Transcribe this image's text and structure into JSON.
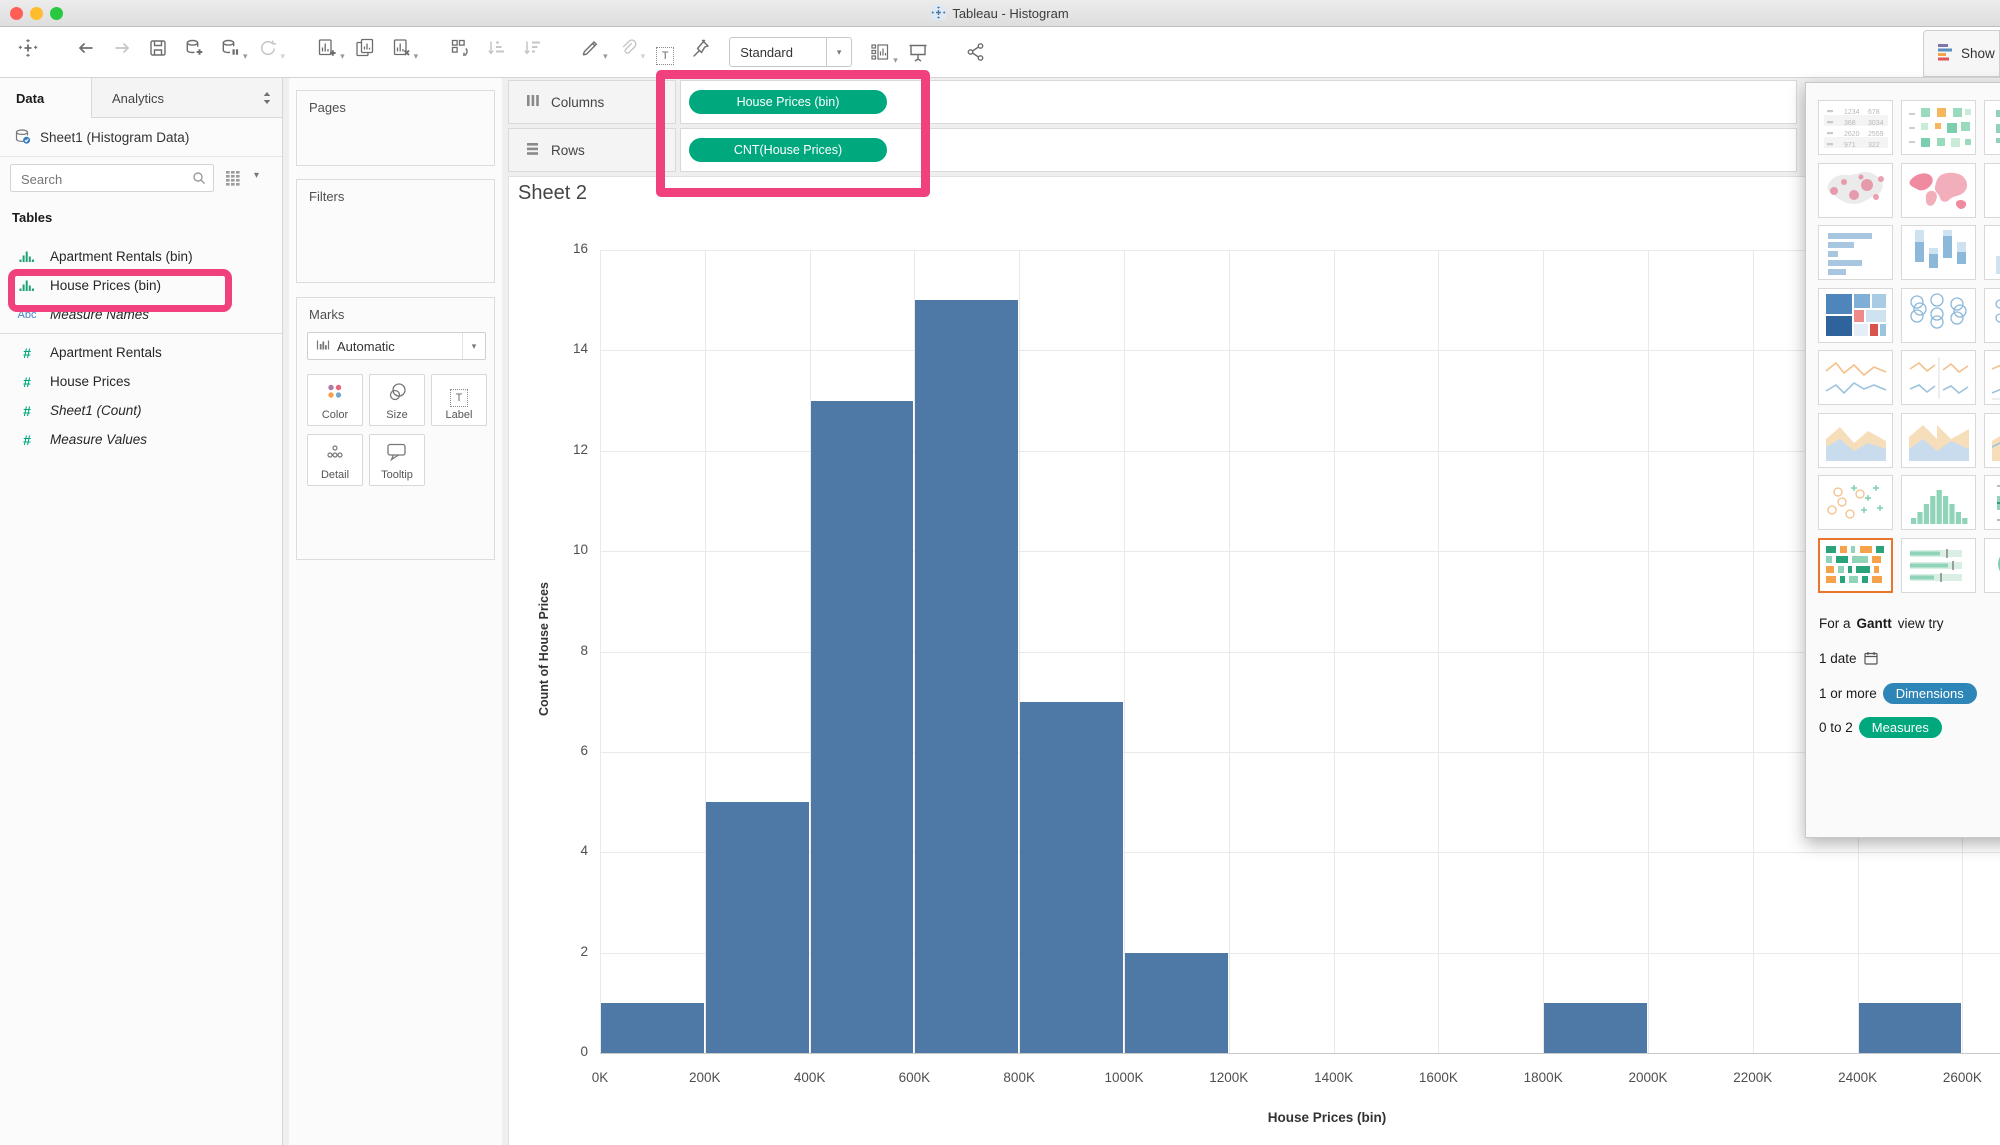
{
  "window": {
    "title": "Tableau - Histogram"
  },
  "toolbar": {
    "items_left": [
      {
        "name": "tableau-logo",
        "disabled": false
      },
      {
        "sep": true
      },
      {
        "name": "back"
      },
      {
        "name": "forward",
        "disabled": true
      },
      {
        "name": "save"
      },
      {
        "name": "new-data-source"
      },
      {
        "name": "pause-data-updates",
        "caret": true
      },
      {
        "name": "refresh-data",
        "disabled": true,
        "caret": true,
        "caret_disabled": true
      },
      {
        "sep": true
      },
      {
        "name": "new-worksheet",
        "caret": true
      },
      {
        "name": "duplicate-sheet"
      },
      {
        "name": "clear-sheet",
        "caret": true
      },
      {
        "sep": true
      },
      {
        "name": "swap-rows-columns"
      },
      {
        "name": "sort-ascending",
        "disabled": true
      },
      {
        "name": "sort-descending",
        "disabled": true
      },
      {
        "sep": true
      },
      {
        "name": "highlight",
        "caret": true
      },
      {
        "name": "format-paperclip",
        "disabled": true,
        "caret": true,
        "caret_disabled": true
      },
      {
        "name": "show-mark-labels"
      },
      {
        "name": "fix-axes-pin"
      }
    ],
    "view_mode_value": "Standard",
    "items_right": [
      {
        "name": "show-hide-cards",
        "caret": true
      },
      {
        "name": "presentation-mode"
      },
      {
        "sep": true
      },
      {
        "name": "share"
      }
    ],
    "show_me_label": "Show Me"
  },
  "sidebar": {
    "tabs": {
      "data": "Data",
      "analytics": "Analytics"
    },
    "connection": "Sheet1 (Histogram Data)",
    "search_placeholder": "Search",
    "tables_label": "Tables",
    "fields": [
      {
        "icon": "histogram",
        "label": "Apartment Rentals (bin)"
      },
      {
        "icon": "histogram",
        "label": "House Prices (bin)",
        "highlighted": true
      },
      {
        "icon": "abc",
        "label": "Measure Names",
        "italic": true,
        "divider_after": true
      },
      {
        "icon": "number",
        "label": "Apartment Rentals"
      },
      {
        "icon": "number",
        "label": "House Prices"
      },
      {
        "icon": "number",
        "label": "Sheet1 (Count)",
        "italic": true
      },
      {
        "icon": "number",
        "label": "Measure Values",
        "italic": true
      }
    ]
  },
  "cards": {
    "pages_label": "Pages",
    "filters_label": "Filters",
    "marks_label": "Marks",
    "mark_type": "Automatic",
    "buttons": [
      {
        "icon": "color",
        "label": "Color"
      },
      {
        "icon": "size",
        "label": "Size"
      },
      {
        "icon": "label",
        "label": "Label"
      },
      {
        "icon": "detail",
        "label": "Detail"
      },
      {
        "icon": "tooltip",
        "label": "Tooltip"
      }
    ]
  },
  "shelves": {
    "columns_label": "Columns",
    "rows_label": "Rows",
    "columns_pills": [
      "House Prices (bin)"
    ],
    "rows_pills": [
      "CNT(House Prices)"
    ]
  },
  "sheet": {
    "title": "Sheet 2"
  },
  "chart_data": {
    "type": "bar",
    "subtype": "histogram",
    "title": "Sheet 2",
    "xlabel": "House Prices (bin)",
    "ylabel": "Count of House Prices",
    "bin_width_k": 200,
    "x_tick_labels": [
      "0K",
      "200K",
      "400K",
      "600K",
      "800K",
      "1000K",
      "1200K",
      "1400K",
      "1600K",
      "1800K",
      "2000K",
      "2200K",
      "2400K",
      "2600K"
    ],
    "x_tick_values_k": [
      0,
      200,
      400,
      600,
      800,
      1000,
      1200,
      1400,
      1600,
      1800,
      2000,
      2200,
      2400,
      2600
    ],
    "y_ticks": [
      0,
      2,
      4,
      6,
      8,
      10,
      12,
      14,
      16
    ],
    "ylim": [
      0,
      16
    ],
    "bin_starts_k": [
      0,
      200,
      400,
      600,
      800,
      1000,
      1200,
      1400,
      1600,
      1800,
      2000,
      2200,
      2400
    ],
    "counts": [
      1,
      5,
      13,
      15,
      7,
      2,
      0,
      0,
      0,
      1,
      0,
      0,
      1
    ],
    "bar_color": "#4E79A7",
    "grid": true,
    "legend": false
  },
  "show_me": {
    "thumbs": [
      {
        "type": "text-table"
      },
      {
        "type": "highlight-table"
      },
      {
        "type": "heat-map"
      },
      {
        "type": "symbol-map"
      },
      {
        "type": "filled-map"
      },
      {
        "type": "pie"
      },
      {
        "type": "horizontal-bars"
      },
      {
        "type": "stacked-bars"
      },
      {
        "type": "side-by-side-bars"
      },
      {
        "type": "treemap"
      },
      {
        "type": "circle-views"
      },
      {
        "type": "side-by-side-circles"
      },
      {
        "type": "lines-continuous"
      },
      {
        "type": "lines-discrete"
      },
      {
        "type": "dual-lines"
      },
      {
        "type": "area-continuous"
      },
      {
        "type": "area-discrete"
      },
      {
        "type": "dual-combination"
      },
      {
        "type": "scatter"
      },
      {
        "type": "histogram"
      },
      {
        "type": "box-and-whisker"
      },
      {
        "type": "gantt",
        "selected": true
      },
      {
        "type": "bullet"
      },
      {
        "type": "packed-bubbles"
      }
    ],
    "text_table_numbers": [
      [
        "1234",
        "678"
      ],
      [
        "368",
        "3034"
      ],
      [
        "2620",
        "2559"
      ],
      [
        "971",
        "322"
      ]
    ],
    "hint_prefix": "For a",
    "hint_bold": "Gantt",
    "hint_suffix": "view try",
    "req1": "1 date",
    "req2_prefix": "1 or more",
    "req2_pill": "Dimensions",
    "req3_prefix": "0 to 2",
    "req3_pill": "Measures"
  },
  "colors": {
    "pill_green": "#00A87E",
    "dimension_pill_blue": "#2E86B8",
    "measure_pill_green": "#00A87E",
    "bar_blue": "#4E79A7",
    "annotation_pink": "#F0407E",
    "selected_thumb_orange": "#E8762D",
    "traffic_red": "#FF5F57",
    "traffic_yellow": "#FEBC2E",
    "traffic_green": "#28C840"
  }
}
